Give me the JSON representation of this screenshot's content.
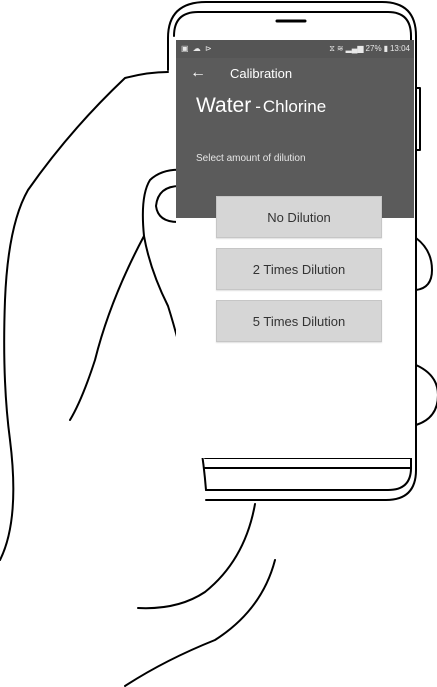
{
  "status_bar": {
    "left_icons": [
      "image-icon",
      "cloud-icon",
      "cast-icon"
    ],
    "time": "13:04",
    "battery": "27%",
    "icons": [
      "vibrate-icon",
      "wifi-icon",
      "signal-icon",
      "battery-icon"
    ]
  },
  "toolbar": {
    "back_icon": "arrow-left-icon",
    "title": "Calibration"
  },
  "header": {
    "sample": "Water",
    "separator": "-",
    "parameter": "Chlorine",
    "instruction": "Select amount of dilution"
  },
  "options": [
    {
      "label": "No Dilution"
    },
    {
      "label": "2 Times Dilution"
    },
    {
      "label": "5 Times Dilution"
    }
  ],
  "colors": {
    "header_bg": "#5b5b5b",
    "button_bg": "#d6d6d6",
    "button_text": "#333333"
  }
}
